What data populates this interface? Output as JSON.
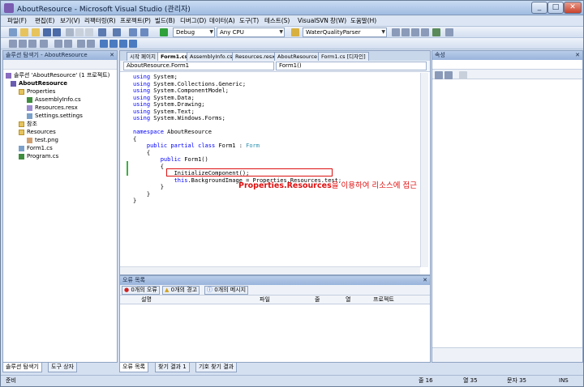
{
  "window": {
    "title": "AboutResource - Microsoft Visual Studio (관리자)"
  },
  "menu": [
    "파일(F)",
    "편집(E)",
    "보기(V)",
    "리팩터링(R)",
    "프로젝트(P)",
    "빌드(B)",
    "디버그(D)",
    "데이터(A)",
    "도구(T)",
    "테스트(S)",
    "VisualSVN",
    "창(W)",
    "도움말(H)"
  ],
  "toolbar": {
    "config": "Debug",
    "platform": "Any CPU",
    "find": "WaterQualityParser"
  },
  "solution_explorer": {
    "title": "솔루션 탐색기 - AboutResource",
    "nodes": [
      {
        "label": "솔루션 'AboutResource' (1 프로젝트)",
        "icon": "solution-icon"
      },
      {
        "label": "AboutResource",
        "icon": "project-icon"
      },
      {
        "label": "Properties",
        "icon": "folder-icon"
      },
      {
        "label": "AssemblyInfo.cs",
        "icon": "csharp-file-icon"
      },
      {
        "label": "Resources.resx",
        "icon": "resx-file-icon"
      },
      {
        "label": "Settings.settings",
        "icon": "settings-file-icon"
      },
      {
        "label": "참조",
        "icon": "folder-icon"
      },
      {
        "label": "Resources",
        "icon": "folder-icon"
      },
      {
        "label": "test.png",
        "icon": "image-file-icon"
      },
      {
        "label": "Form1.cs",
        "icon": "form-file-icon"
      },
      {
        "label": "Program.cs",
        "icon": "csharp-file-icon"
      }
    ],
    "bottom_tabs": [
      "솔루션 탐색기",
      "도구 상자"
    ]
  },
  "editor": {
    "tabs": [
      "시작 페이지",
      "Form1.cs",
      "AssemblyInfo.cs",
      "Resources.resx",
      "AboutResource",
      "Form1.cs [디자인]"
    ],
    "active_tab": "Form1.cs",
    "nav_left": "AboutResource.Form1",
    "nav_right": "Form1()",
    "lines": [
      "using System;",
      "using System.Collections.Generic;",
      "using System.ComponentModel;",
      "using System.Data;",
      "using System.Drawing;",
      "using System.Text;",
      "using System.Windows.Forms;",
      "",
      "namespace AboutResource",
      "{",
      "    public partial class Form1 : Form",
      "    {",
      "        public Form1()",
      "        {",
      "            InitializeComponent();",
      "            this.BackgroundImage = Properties.Resources.test;",
      "        }",
      "    }",
      "}"
    ],
    "annotation_bold": "Properties.Resources",
    "annotation_rest": "을 이용하여 리소스에 접근"
  },
  "error_list": {
    "title": "오류 목록",
    "errors": "0개의 오류",
    "warnings": "0개의 경고",
    "messages": "0개의 메시지",
    "columns": [
      "설명",
      "파일",
      "줄",
      "열",
      "프로젝트"
    ],
    "bottom_tabs": [
      "오류 목록",
      "찾기 결과 1",
      "기호 찾기 결과"
    ]
  },
  "properties": {
    "title": "속성"
  },
  "status": {
    "ready": "준비",
    "line": "줄 16",
    "col": "열 35",
    "ch": "문자 35",
    "mode": "INS"
  },
  "colors": {
    "keyword": "#0000ff",
    "type": "#2b91af",
    "annotation": "#e01010",
    "highlight_border": "#dd1111"
  }
}
